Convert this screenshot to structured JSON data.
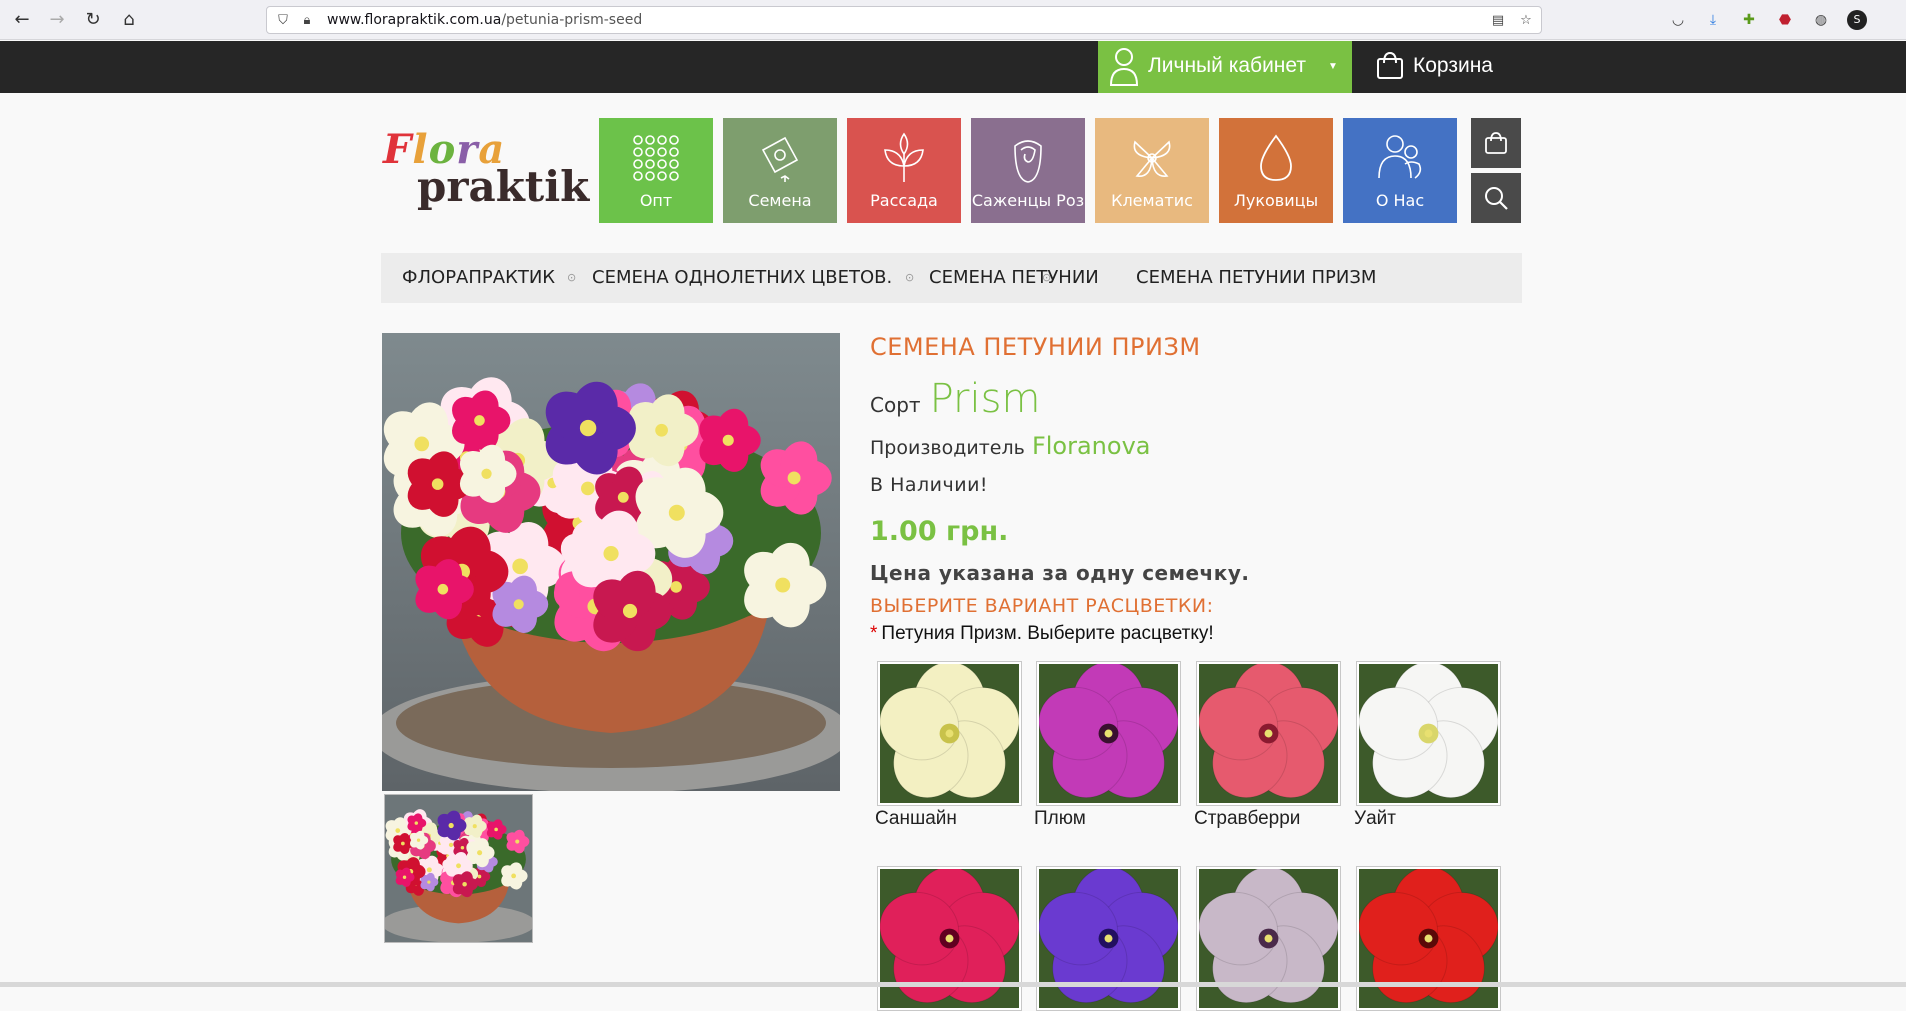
{
  "browser": {
    "url_host": "www.florapraktik.com.ua",
    "url_path": "/petunia-prism-seed",
    "back": "←",
    "forward": "→",
    "reload": "↻",
    "home": "⌂"
  },
  "topbar": {
    "account_label": "Личный кабинет",
    "cart_label": "Корзина"
  },
  "logo": {
    "line1": "Flora",
    "line2": "praktik"
  },
  "nav": [
    {
      "label": "Опт",
      "color": "#6cc24a",
      "icon": "grid-icon"
    },
    {
      "label": "Семена",
      "color": "#7e9e6e",
      "icon": "seed-packet-icon"
    },
    {
      "label": "Рассада",
      "color": "#d9534f",
      "icon": "seedling-icon"
    },
    {
      "label": "Саженцы Роз",
      "color": "#8a6f8f",
      "icon": "rose-icon"
    },
    {
      "label": "Клематис",
      "color": "#e8b97f",
      "icon": "clematis-icon"
    },
    {
      "label": "Луковицы",
      "color": "#d2723a",
      "icon": "bulb-icon"
    },
    {
      "label": "О Нас",
      "color": "#4472c4",
      "icon": "people-icon"
    }
  ],
  "breadcrumb": [
    "ФЛОРАПРАКТИК",
    "СЕМЕНА ОДНОЛЕТНИХ ЦВЕТОВ.",
    "СЕМЕНА ПЕТУНИИ",
    "СЕМЕНА ПЕТУНИИ ПРИЗМ"
  ],
  "product": {
    "title": "СЕМЕНА ПЕТУНИИ ПРИЗМ",
    "sort_label": "Сорт",
    "sort_value": "Prism",
    "maker_label": "Производитель",
    "maker_value": "Floranova",
    "stock": "В Наличии!",
    "price": "1.00 грн.",
    "price_note": "Цена указана за одну семечку.",
    "choose_label": "ВЫБЕРИТЕ ВАРИАНТ РАСЦВЕТКИ:",
    "required_star": "*",
    "required_text": "Петуния Призм. Выберите расцветку!"
  },
  "variants": [
    {
      "name": "Саншайн",
      "petal": "#f3f0c2",
      "center": "#c8c24a"
    },
    {
      "name": "Плюм",
      "petal": "#c23ab7",
      "center": "#3a1030"
    },
    {
      "name": "Стравберри",
      "petal": "#e65a6e",
      "center": "#8a1a30"
    },
    {
      "name": "Уайт",
      "petal": "#f6f6f4",
      "center": "#d9d66a"
    },
    {
      "name": "",
      "petal": "#e0205a",
      "center": "#600020"
    },
    {
      "name": "",
      "petal": "#6a3ad0",
      "center": "#221060"
    },
    {
      "name": "",
      "petal": "#c8b8c8",
      "center": "#4a2a4a"
    },
    {
      "name": "",
      "petal": "#e0201c",
      "center": "#5a0a08"
    }
  ],
  "colors": {
    "accent_green": "#7ac143",
    "accent_orange": "#e07033",
    "topbar": "#262626"
  }
}
